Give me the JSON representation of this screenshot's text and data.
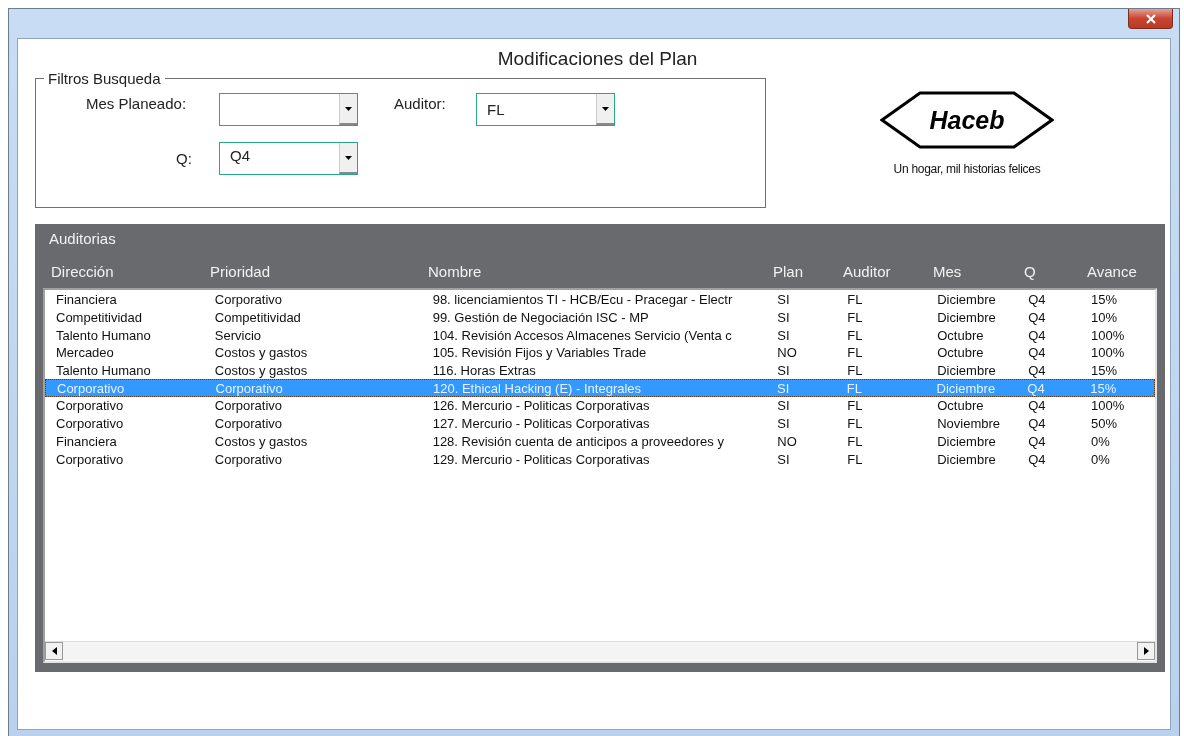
{
  "window": {
    "title": "Modificaciones del Plan"
  },
  "filters": {
    "legend": "Filtros Busqueda",
    "fields": [
      {
        "label": "Mes Planeado:"
      },
      {
        "label": "Auditor:",
        "value": "FL"
      },
      {
        "label": "Q:",
        "value": "Q4"
      }
    ]
  },
  "logo": {
    "brand": "Haceb",
    "tagline": "Un hogar, mil historias felices"
  },
  "panel": {
    "title": "Auditorias",
    "columns": [
      "Dirección",
      "Prioridad",
      "Nombre",
      "Plan",
      "Auditor",
      "Mes",
      "Q",
      "Avance"
    ],
    "rows": [
      {
        "cells": [
          "Financiera",
          "Corporativo",
          "98. licenciamientos TI - HCB/Ecu - Pracegar - Electr",
          "SI",
          "FL",
          "Diciembre",
          "Q4",
          "15%"
        ],
        "selected": false
      },
      {
        "cells": [
          "Competitividad",
          "Competitividad",
          "99. Gestión de Negociación ISC - MP",
          "SI",
          "FL",
          "Diciembre",
          "Q4",
          "10%"
        ],
        "selected": false
      },
      {
        "cells": [
          "Talento Humano",
          "Servicio",
          "104. Revisión Accesos Almacenes Servicio (Venta c",
          "SI",
          "FL",
          "Octubre",
          "Q4",
          "100%"
        ],
        "selected": false
      },
      {
        "cells": [
          "Mercadeo",
          "Costos y gastos",
          "105. Revisión Fijos y Variables Trade",
          "NO",
          "FL",
          "Octubre",
          "Q4",
          "100%"
        ],
        "selected": false
      },
      {
        "cells": [
          "Talento Humano",
          "Costos y gastos",
          "116. Horas Extras",
          "SI",
          "FL",
          "Diciembre",
          "Q4",
          "15%"
        ],
        "selected": false
      },
      {
        "cells": [
          "Corporativo",
          "Corporativo",
          "120. Ethical Hacking (E) - Integrales",
          "SI",
          "FL",
          "Diciembre",
          "Q4",
          "15%"
        ],
        "selected": true
      },
      {
        "cells": [
          "Corporativo",
          "Corporativo",
          "126. Mercurio - Politicas Corporativas",
          "SI",
          "FL",
          "Octubre",
          "Q4",
          "100%"
        ],
        "selected": false
      },
      {
        "cells": [
          "Corporativo",
          "Corporativo",
          "127. Mercurio - Politicas Corporativas",
          "SI",
          "FL",
          "Noviembre",
          "Q4",
          "50%"
        ],
        "selected": false
      },
      {
        "cells": [
          "Financiera",
          "Costos y gastos",
          "128. Revisión cuenta de anticipos a proveedores y",
          "NO",
          "FL",
          "Diciembre",
          "Q4",
          "0%"
        ],
        "selected": false
      },
      {
        "cells": [
          "Corporativo",
          "Corporativo",
          "129. Mercurio - Politicas Corporativas",
          "SI",
          "FL",
          "Diciembre",
          "Q4",
          "0%"
        ],
        "selected": false
      }
    ]
  }
}
